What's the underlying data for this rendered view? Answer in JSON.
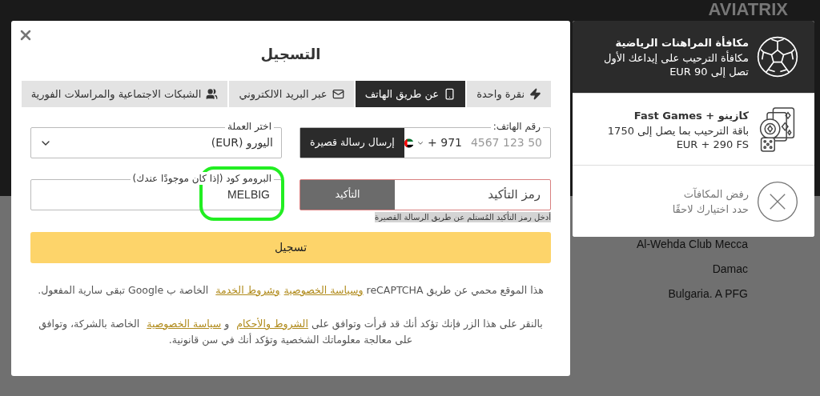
{
  "background": {
    "logo": "AVIATRIX",
    "rows": [
      {
        "text": "Al-Wehda Club Mecca"
      },
      {
        "text": "Damac"
      },
      {
        "text": "Bulgaria. A PFG"
      }
    ]
  },
  "modal": {
    "title": "التسجيل",
    "tabs": [
      {
        "label": "نقرة واحدة",
        "selected": false
      },
      {
        "label": "عن طريق الهاتف",
        "selected": true
      },
      {
        "label": "عبر البريد الالكتروني",
        "selected": false
      },
      {
        "label": "الشبكات الاجتماعية والمراسلات الفورية",
        "selected": false
      }
    ],
    "phone": {
      "label": "رقم الهاتف:",
      "placeholder": "50 123 4567",
      "code": "+ 971",
      "button": "إرسال رسالة قصيرة"
    },
    "currency": {
      "label": "اختر العملة",
      "value": "اليورو (EUR)"
    },
    "confirmation": {
      "placeholder": "رمز التأكيد",
      "button": "التأكيد",
      "hint": "أدخل رمز التأكيد المُستلم عن طريق الرسالة القصيرة",
      "error": true
    },
    "promo": {
      "label": "البرومو كود (إذا كان موجودًا عندك)",
      "value": "MELBIG",
      "highlighted": true
    },
    "submit": "تسجيل",
    "recaptcha_notice": [
      {
        "kind": "text",
        "text": "هذا الموقع محمي عن طريق reCAPTCHA "
      },
      {
        "kind": "link",
        "text": "وسياسة الخصوصية"
      },
      {
        "kind": "link",
        "text": "وشروط الخدمة"
      },
      {
        "kind": "text",
        "text": " الخاصة ب Google تبقى سارية المفعول."
      }
    ],
    "consent": [
      {
        "kind": "text",
        "text": "بالنقر على هذا الزر فإنك تؤكد أنك قد قرأت وتوافق على "
      },
      {
        "kind": "link",
        "text": "الشروط والأحكام"
      },
      {
        "kind": "text",
        "text": " و "
      },
      {
        "kind": "link",
        "text": "سياسة الخصوصية"
      },
      {
        "kind": "text",
        "text": " الخاصة بالشركة، وتوافق على معالجة معلوماتك الشخصية وتؤكد أنك في سن قانونية."
      }
    ]
  },
  "bonuses": [
    {
      "kind": "sports",
      "title": "مكافأة المراهنات الرياضية",
      "text": "مكافأة الترحيب على إيداعك الأول تصل إلى 90 EUR",
      "selected": true
    },
    {
      "kind": "casino",
      "title": "كازينو + Fast Games",
      "text": "باقة الترحيب بما يصل إلى 1750 EUR + 290 FS",
      "selected": false
    },
    {
      "kind": "decline",
      "title": "رفض المكافآت",
      "text": "حدد اختيارك لاحقًا",
      "selected": false
    }
  ]
}
